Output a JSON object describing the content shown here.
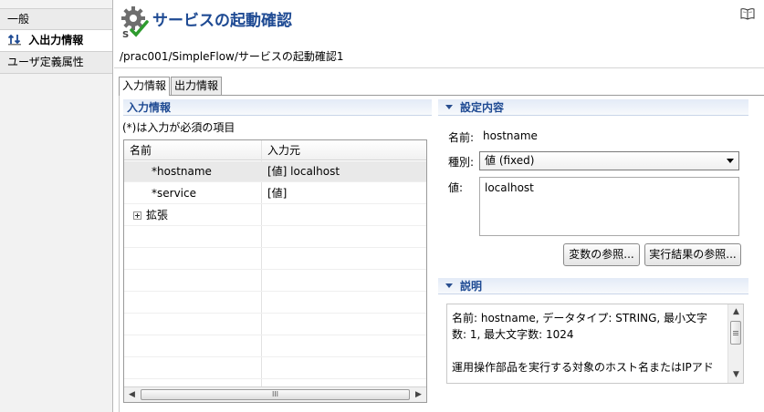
{
  "sidebar": {
    "items": [
      {
        "label": "一般"
      },
      {
        "label": "入出力情報"
      },
      {
        "label": "ユーザ定義属性"
      }
    ]
  },
  "header": {
    "title": "サービスの起動確認",
    "path": "/prac001/SimpleFlow/サービスの起動確認1"
  },
  "tabs": [
    {
      "label": "入力情報"
    },
    {
      "label": "出力情報"
    }
  ],
  "input_section": {
    "title": "入力情報",
    "required_note": "(*)は入力が必須の項目",
    "columns": [
      "名前",
      "入力元"
    ],
    "rows": [
      {
        "name": "*hostname",
        "source": "[値] localhost"
      },
      {
        "name": "*service",
        "source": "[値]"
      },
      {
        "name": "拡張",
        "source": ""
      }
    ],
    "scroll_grip": "III"
  },
  "settings_section": {
    "title": "設定内容",
    "name_label": "名前:",
    "name_value": "hostname",
    "type_label": "種別:",
    "type_value": "値 (fixed)",
    "value_label": "値:",
    "value_text": "localhost",
    "var_ref_button": "変数の参照...",
    "result_ref_button": "実行結果の参照..."
  },
  "description_section": {
    "title": "説明",
    "text_line1": "名前: hostname, データタイプ: STRING, 最小文字",
    "text_line2": "数: 1, 最大文字数: 1024",
    "text_line3": "運用操作部品を実行する対象のホスト名またはIPアド"
  },
  "colors": {
    "accent": "#1e4a93",
    "check": "#2e9b2e",
    "gear": "#6e6e6e"
  },
  "icons": {
    "gear_check": "gear-check-icon",
    "io": "io-arrows-icon",
    "help": "book-icon"
  }
}
